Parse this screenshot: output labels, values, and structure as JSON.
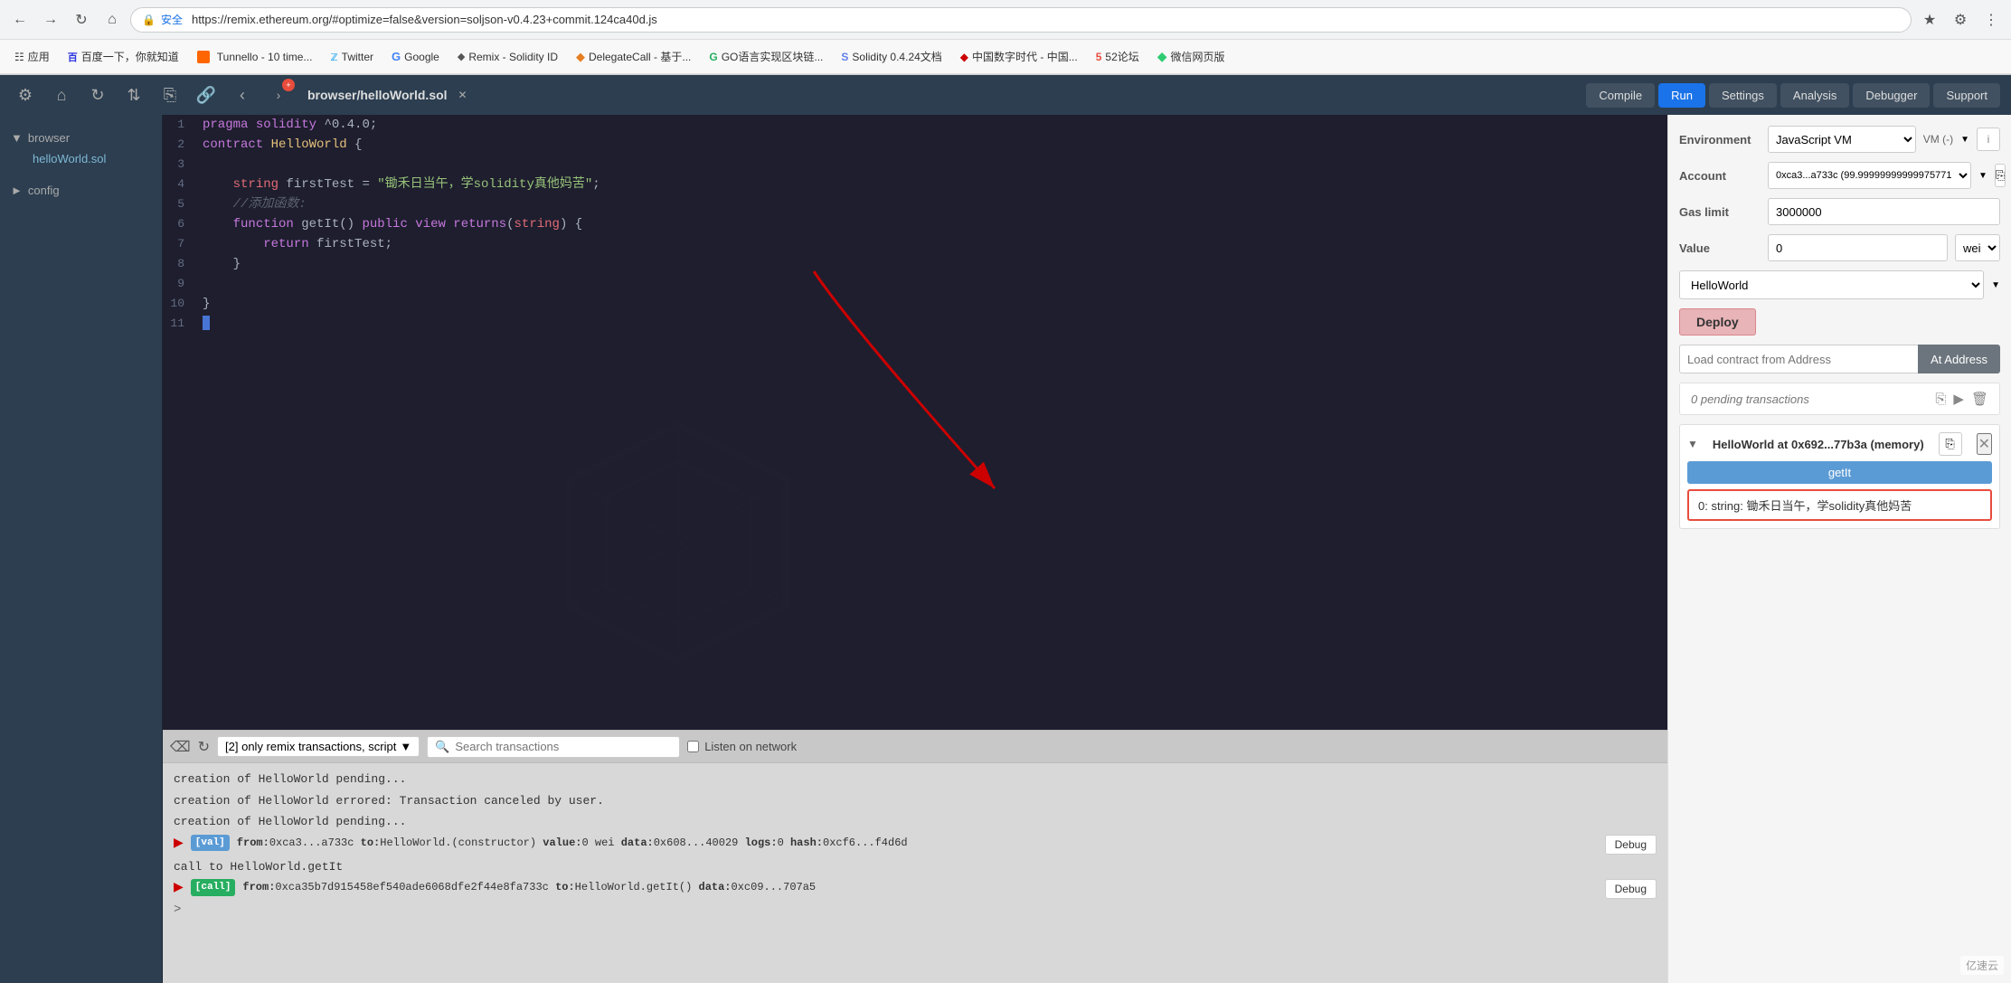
{
  "browser": {
    "address": "https://remix.ethereum.org/#optimize=false&version=soljson-v0.4.23+commit.124ca40d.js",
    "security_label": "安全"
  },
  "bookmarks": [
    {
      "label": "应用",
      "icon": "grid"
    },
    {
      "label": "百度一下，你就知道",
      "icon": "baidu"
    },
    {
      "label": "Tunnello - 10 time...",
      "icon": "tunnello"
    },
    {
      "label": "Twitter",
      "icon": "twitter"
    },
    {
      "label": "Google",
      "icon": "google"
    },
    {
      "label": "Remix - Solidity ID",
      "icon": "remix"
    },
    {
      "label": "DelegateCall - 基于...",
      "icon": "delegate"
    },
    {
      "label": "GO语言实现区块链...",
      "icon": "go"
    },
    {
      "label": "Solidity 0.4.24文档",
      "icon": "sol"
    },
    {
      "label": "中国数字时代 - 中国...",
      "icon": "china"
    },
    {
      "label": "52论坛",
      "icon": "forum"
    },
    {
      "label": "微信网页版",
      "icon": "wechat"
    }
  ],
  "toolbar": {
    "file_name": "browser/helloWorld.sol",
    "tabs": [
      "Compile",
      "Run",
      "Settings",
      "Analysis",
      "Debugger",
      "Support"
    ]
  },
  "sidebar": {
    "browser_label": "browser",
    "file": "helloWorld.sol",
    "config_label": "config"
  },
  "code": {
    "lines": [
      {
        "num": 1,
        "content": "pragma solidity ^0.4.0;"
      },
      {
        "num": 2,
        "content": "contract HelloWorld {"
      },
      {
        "num": 3,
        "content": ""
      },
      {
        "num": 4,
        "content": "    string firstTest = \"锄禾日当午，学solidity真他妈苦\";"
      },
      {
        "num": 5,
        "content": "    //添加函数:"
      },
      {
        "num": 6,
        "content": "    function getIt() public view returns(string) {"
      },
      {
        "num": 7,
        "content": "        return firstTest;"
      },
      {
        "num": 8,
        "content": "    }"
      },
      {
        "num": 9,
        "content": ""
      },
      {
        "num": 10,
        "content": "}"
      },
      {
        "num": 11,
        "content": ""
      }
    ]
  },
  "right_panel": {
    "environment_label": "Environment",
    "environment_value": "JavaScript VM",
    "vm_label": "VM (-)",
    "account_label": "Account",
    "account_value": "0xca3...a733c (99.99999999999975771",
    "gas_limit_label": "Gas limit",
    "gas_limit_value": "3000000",
    "value_label": "Value",
    "value_num": "0",
    "value_unit": "wei",
    "contract_select": "HelloWorld",
    "deploy_btn": "Deploy",
    "load_contract_placeholder": "Load contract from Address",
    "at_address_btn": "At Address",
    "pending_text": "0 pending transactions",
    "deployed_title": "HelloWorld at 0x692...77b3a (memory)",
    "getit_btn": "getIt",
    "result_text": "0: string: 锄禾日当午，学solidity真他妈苦"
  },
  "console": {
    "filter_label": "[2] only remix transactions, script",
    "search_placeholder": "Search transactions",
    "listen_label": "Listen on network",
    "lines": [
      {
        "type": "text",
        "content": "creation of HelloWorld pending..."
      },
      {
        "type": "text",
        "content": "creation of HelloWorld errored: Transaction canceled by user."
      },
      {
        "type": "text",
        "content": "creation of HelloWorld pending..."
      },
      {
        "type": "tx",
        "badge": "val",
        "details": "from:0xca3...a733c to:HelloWorld.(constructor) value:0 wei data:0x608...40029 logs:0 hash:0xcf6...f4d6d"
      },
      {
        "type": "text",
        "content": "call to HelloWorld.getIt"
      },
      {
        "type": "tx",
        "badge": "call",
        "details": "from:0xca35b7d915458ef540ade6068dfe2f44e8fa733c to:HelloWorld.getIt() data:0xc09...707a5"
      }
    ],
    "prompt": ">"
  }
}
